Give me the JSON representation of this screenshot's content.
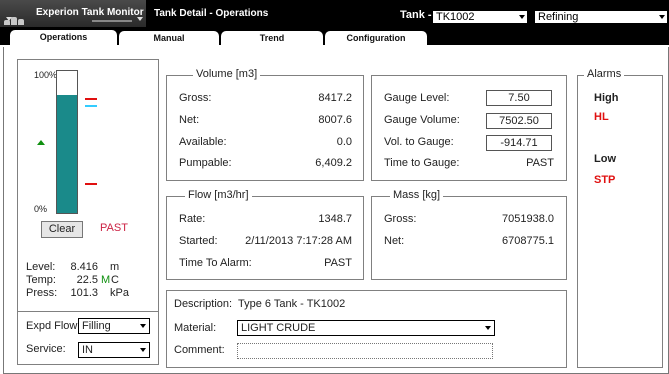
{
  "header": {
    "app_title": "Experion Tank Monitor",
    "page_title": "Tank Detail - Operations",
    "tank_label": "Tank -",
    "tank_value": "TK1002",
    "group_value": "Refining"
  },
  "tabs": [
    {
      "label": "Operations",
      "active": true
    },
    {
      "label": "Manual",
      "active": false
    },
    {
      "label": "Trend",
      "active": false
    },
    {
      "label": "Configuration",
      "active": false
    }
  ],
  "level_panel": {
    "scale_top": "100%",
    "scale_bottom": "0%",
    "fill_fraction": 0.83,
    "clear_label": "Clear",
    "status": "PAST",
    "readings": [
      {
        "label": "Level:",
        "value": "8.416",
        "unit": "m",
        "flag": ""
      },
      {
        "label": "Temp:",
        "value": "22.5",
        "unit": "C",
        "flag": "M"
      },
      {
        "label": "Press:",
        "value": "101.3",
        "unit": "kPa",
        "flag": ""
      }
    ],
    "expd_flow": {
      "label": "Expd Flow",
      "value": "Filling"
    },
    "service": {
      "label": "Service:",
      "value": "IN"
    }
  },
  "volume": {
    "title": "Volume [m3]",
    "rows": [
      {
        "label": "Gross:",
        "value": "8417.2"
      },
      {
        "label": "Net:",
        "value": "8007.6"
      },
      {
        "label": "Available:",
        "value": "0.0"
      },
      {
        "label": "Pumpable:",
        "value": "6,409.2"
      }
    ]
  },
  "gauge": {
    "rows": [
      {
        "label": "Gauge Level:",
        "value": "7.50"
      },
      {
        "label": "Gauge Volume:",
        "value": "7502.50"
      },
      {
        "label": "Vol. to Gauge:",
        "value": "-914.71"
      }
    ],
    "time_label": "Time to Gauge:",
    "time_value": "PAST"
  },
  "flow": {
    "title": "Flow [m3/hr]",
    "rows": [
      {
        "label": "Rate:",
        "value": "1348.7"
      },
      {
        "label": "Started:",
        "value": "2/11/2013 7:17:28 AM"
      },
      {
        "label": "Time To Alarm:",
        "value": "PAST"
      }
    ]
  },
  "mass": {
    "title": "Mass [kg]",
    "rows": [
      {
        "label": "Gross:",
        "value": "7051938.0"
      },
      {
        "label": "Net:",
        "value": "6708775.1"
      }
    ]
  },
  "description": {
    "desc_label": "Description:",
    "desc_value": "Type 6 Tank - TK1002",
    "material_label": "Material:",
    "material_value": "LIGHT CRUDE",
    "comment_label": "Comment:",
    "comment_value": ""
  },
  "alarms": {
    "title": "Alarms",
    "high_label": "High",
    "high_value": "HL",
    "low_label": "Low",
    "low_value": "STP"
  },
  "colors": {
    "tank_fill": "#1a8a8a",
    "alarm_red": "#e01010",
    "marker_cyan": "#33ccff",
    "marker_green": "#109010",
    "status_red": "#cc2244"
  }
}
